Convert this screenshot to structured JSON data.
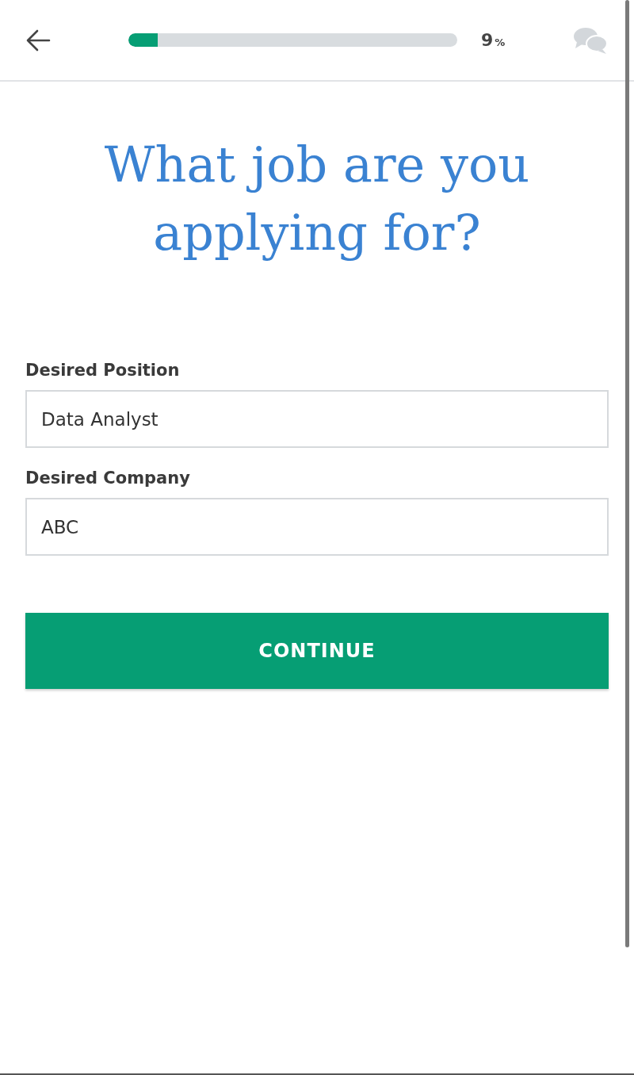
{
  "header": {
    "progress": {
      "level": 0.09,
      "value": "9",
      "unit": "%"
    }
  },
  "title": "What job are you applying for?",
  "fields": [
    {
      "label": "Desired Position",
      "value": "Data Analyst"
    },
    {
      "label": "Desired Company",
      "value": "ABC"
    }
  ],
  "button": "CONTINUE"
}
